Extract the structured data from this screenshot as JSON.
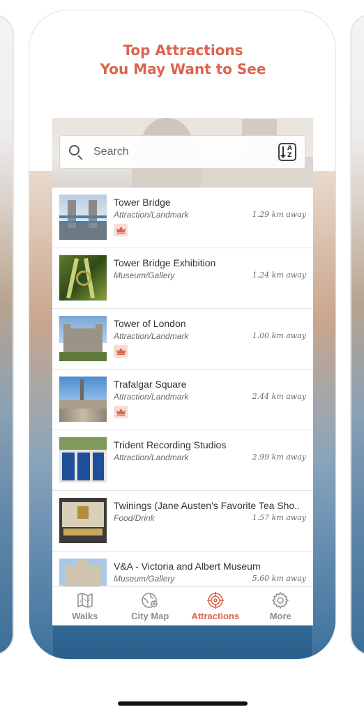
{
  "headline": {
    "line1": "Top Attractions",
    "line2": "You May Want to See"
  },
  "search": {
    "placeholder": "Search"
  },
  "attractions": [
    {
      "name": "Tower Bridge",
      "category": "Attraction/Landmark",
      "distance": "1.29 km away",
      "featured": true
    },
    {
      "name": "Tower Bridge Exhibition",
      "category": "Museum/Gallery",
      "distance": "1.24 km away",
      "featured": false
    },
    {
      "name": "Tower of London",
      "category": "Attraction/Landmark",
      "distance": "1.00 km away",
      "featured": true
    },
    {
      "name": "Trafalgar Square",
      "category": "Attraction/Landmark",
      "distance": "2.44 km away",
      "featured": true
    },
    {
      "name": "Trident Recording Studios",
      "category": "Attraction/Landmark",
      "distance": "2.99 km away",
      "featured": false
    },
    {
      "name": "Twinings (Jane Austen's Favorite Tea Sho..",
      "category": "Food/Drink",
      "distance": "1.57 km away",
      "featured": false
    },
    {
      "name": "V&A - Victoria and Albert Museum",
      "category": "Museum/Gallery",
      "distance": "5.60 km away",
      "featured": false
    }
  ],
  "tabs": [
    {
      "label": "Walks",
      "icon": "map-icon",
      "active": false
    },
    {
      "label": "City Map",
      "icon": "globe-pin-icon",
      "active": false
    },
    {
      "label": "Attractions",
      "icon": "target-icon",
      "active": true
    },
    {
      "label": "More",
      "icon": "gear-icon",
      "active": false
    }
  ],
  "colors": {
    "accent": "#dc634d",
    "badge_bg": "#f7dcd6",
    "inactive_tab": "#8e8e8e"
  }
}
